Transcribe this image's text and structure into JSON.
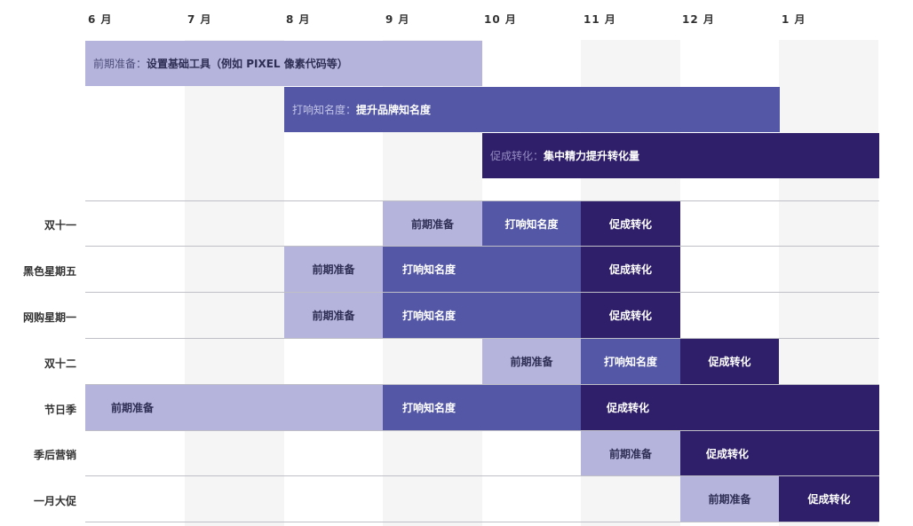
{
  "months": [
    "6 月",
    "7 月",
    "8 月",
    "9 月",
    "10 月",
    "11 月",
    "12 月",
    "1 月"
  ],
  "phases": [
    {
      "prefix": "前期准备：",
      "text": "设置基础工具（例如 PIXEL 像素代码等）"
    },
    {
      "prefix": "打响知名度：",
      "text": "提升品牌知名度"
    },
    {
      "prefix": "促成转化：",
      "text": "集中精力提升转化量"
    }
  ],
  "rows": [
    {
      "label": "双十一",
      "blocks": [
        {
          "stage": "前期准备"
        },
        {
          "stage": "打响知名度"
        },
        {
          "stage": "促成转化"
        }
      ]
    },
    {
      "label": "黑色星期五",
      "blocks": [
        {
          "stage": "前期准备"
        },
        {
          "stage": "打响知名度"
        },
        {
          "stage": "促成转化"
        }
      ]
    },
    {
      "label": "网购星期一",
      "blocks": [
        {
          "stage": "前期准备"
        },
        {
          "stage": "打响知名度"
        },
        {
          "stage": "促成转化"
        }
      ]
    },
    {
      "label": "双十二",
      "blocks": [
        {
          "stage": "前期准备"
        },
        {
          "stage": "打响知名度"
        },
        {
          "stage": "促成转化"
        }
      ]
    },
    {
      "label": "节日季",
      "blocks": [
        {
          "stage": "前期准备"
        },
        {
          "stage": "打响知名度"
        },
        {
          "stage": "促成转化"
        }
      ]
    },
    {
      "label": "季后营销",
      "blocks": [
        {
          "stage": "前期准备"
        },
        {
          "stage": "促成转化"
        }
      ]
    },
    {
      "label": "一月大促",
      "blocks": [
        {
          "stage": "前期准备"
        },
        {
          "stage": "促成转化"
        }
      ]
    }
  ],
  "colors": {
    "prep": "#b4b4dc",
    "awareness": "#5357a6",
    "conversion": "#2f1f6a"
  }
}
